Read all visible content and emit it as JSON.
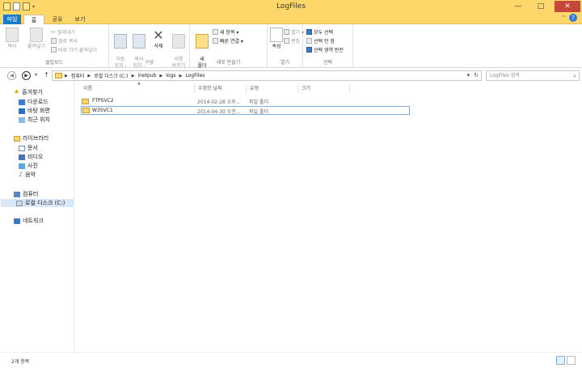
{
  "window": {
    "title": "LogFiles",
    "minimize": "—",
    "maximize": "□",
    "close": "✕"
  },
  "tabs": [
    {
      "label": "파일"
    },
    {
      "label": "홈"
    },
    {
      "label": "공유"
    },
    {
      "label": "보기"
    }
  ],
  "ribbon": {
    "clipboard": {
      "label": "클립보드",
      "copy": "복사",
      "paste": "붙여넣기",
      "cut": "잘라내기",
      "copy_path": "경로 복사",
      "paste_shortcut": "바로 가기 붙여넣기"
    },
    "organize": {
      "label": "구성",
      "move_to": "이동\n위치 -",
      "copy_to": "복사\n위치 -",
      "delete": "삭제",
      "rename": "이름\n바꾸기"
    },
    "new": {
      "label": "새로 만들기",
      "new_folder": "새\n폴더",
      "new_item": "새 항목 ▾",
      "easy_access": "빠른 연결 ▾"
    },
    "open": {
      "label": "열기",
      "properties": "속성",
      "open": "열기 ▾",
      "edit": "편집"
    },
    "select": {
      "label": "선택",
      "select_all": "모두 선택",
      "select_none": "선택 안 함",
      "invert": "선택 영역 반전"
    }
  },
  "address": {
    "crumbs": [
      "컴퓨터",
      "로컬 디스크 (C:)",
      "inetpub",
      "logs",
      "LogFiles"
    ],
    "search_placeholder": "LogFiles 검색"
  },
  "nav": {
    "favorites": "즐겨찾기",
    "downloads": "다운로드",
    "desktop": "바탕 화면",
    "recent": "최근 위치",
    "libraries": "라이브러리",
    "documents": "문서",
    "videos": "비디오",
    "pictures": "사진",
    "music": "음악",
    "computer": "컴퓨터",
    "local_disk": "로컬 디스크 (C:)",
    "network": "네트워크"
  },
  "columns": [
    "이름",
    "수정한 날짜",
    "유형",
    "크기"
  ],
  "files": [
    {
      "name": "FTPSVC2",
      "date": "2014-02-28 오후...",
      "type": "파일 폴더",
      "size": ""
    },
    {
      "name": "W3SVC1",
      "date": "2014-04-30 오전...",
      "type": "파일 폴더",
      "size": ""
    }
  ],
  "status": {
    "count": "2개 항목"
  }
}
